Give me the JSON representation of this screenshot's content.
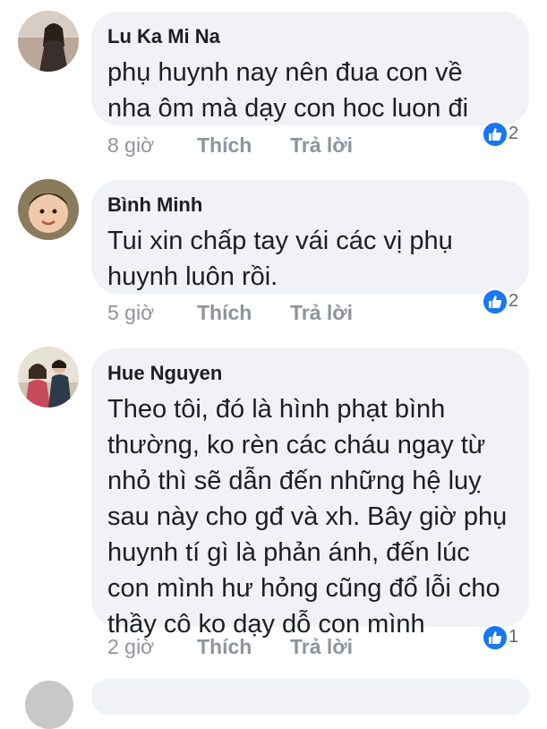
{
  "comments": [
    {
      "author": "Lu Ka Mi Na",
      "lines": [
        "phụ huynh nay nên đua con về",
        "nha ôm mà dạy con hoc luon đi"
      ],
      "time": "8 giờ",
      "like_label": "Thích",
      "reply_label": "Trả lời",
      "reaction_icon": "like-icon",
      "reaction_count": "2"
    },
    {
      "author": "Bình Minh",
      "lines": [
        "Tui xin chấp tay vái các vị phụ",
        "huynh luôn rồi."
      ],
      "time": "5 giờ",
      "like_label": "Thích",
      "reply_label": "Trả lời",
      "reaction_icon": "like-icon",
      "reaction_count": "2"
    },
    {
      "author": "Hue Nguyen",
      "lines": [
        "Theo tôi, đó là hình phạt bình",
        "thường, ko rèn các cháu ngay từ",
        "nhỏ thì sẽ dẫn đến những hệ luỵ",
        "sau này cho gđ và xh. Bây giờ phụ",
        "huynh tí gì là phản ánh, đến lúc",
        "con mình hư hỏng cũng đổ lỗi cho",
        "thầy cô ko dạy dỗ con mình"
      ],
      "time": "2 giờ",
      "like_label": "Thích",
      "reply_label": "Trả lời",
      "reaction_icon": "like-icon",
      "reaction_count": "1"
    }
  ],
  "colors": {
    "bubble": "#f0f2f5",
    "like_blue": "#1877f2",
    "meta_text": "#90949c"
  }
}
